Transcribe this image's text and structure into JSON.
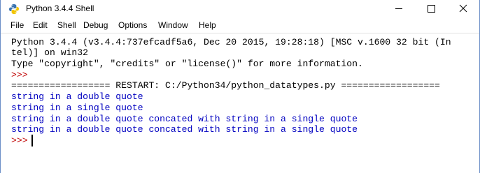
{
  "window": {
    "title": "Python 3.4.4 Shell",
    "icons": {
      "app": "python-icon",
      "minimize": "minimize-icon",
      "maximize": "maximize-icon",
      "close": "close-icon"
    }
  },
  "menu": {
    "items": [
      "File",
      "Edit",
      "Shell",
      "Debug",
      "Options",
      "Window",
      "Help"
    ]
  },
  "shell": {
    "banner_line1": "Python 3.4.4 (v3.4.4:737efcadf5a6, Dec 20 2015, 19:28:18) [MSC v.1600 32 bit (In",
    "banner_line2": "tel)] on win32",
    "banner_line3": "Type \"copyright\", \"credits\" or \"license()\" for more information.",
    "prompt1": ">>>",
    "restart_line": "================== RESTART: C:/Python34/python_datatypes.py ==================",
    "outputs": [
      "string in a double quote",
      "string in a single quote",
      "string in a double quote concated with string in a single quote",
      "string in a double quote concated with string in a single quote"
    ],
    "prompt2": ">>>"
  },
  "colors": {
    "stdout": "#0000c0",
    "prompt": "#c00000",
    "text": "#000000",
    "border": "#6b8fc7"
  }
}
